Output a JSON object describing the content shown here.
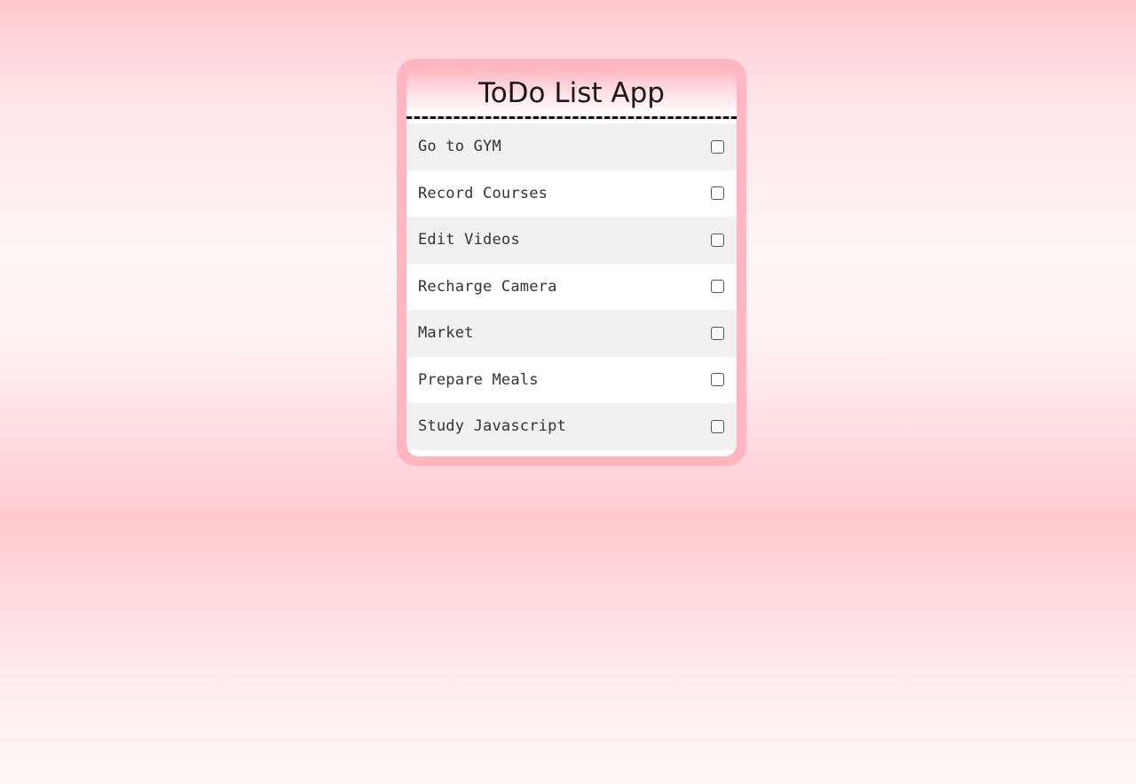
{
  "app": {
    "title": "ToDo List App"
  },
  "todos": [
    {
      "label": "Go to GYM",
      "checked": false
    },
    {
      "label": "Record Courses",
      "checked": false
    },
    {
      "label": "Edit Videos",
      "checked": false
    },
    {
      "label": "Recharge Camera",
      "checked": false
    },
    {
      "label": "Market",
      "checked": false
    },
    {
      "label": "Prepare Meals",
      "checked": false
    },
    {
      "label": "Study Javascript",
      "checked": false
    }
  ],
  "colors": {
    "card_border": "#ffb6c1",
    "row_alt": "#f1f1f1",
    "row": "#ffffff"
  }
}
